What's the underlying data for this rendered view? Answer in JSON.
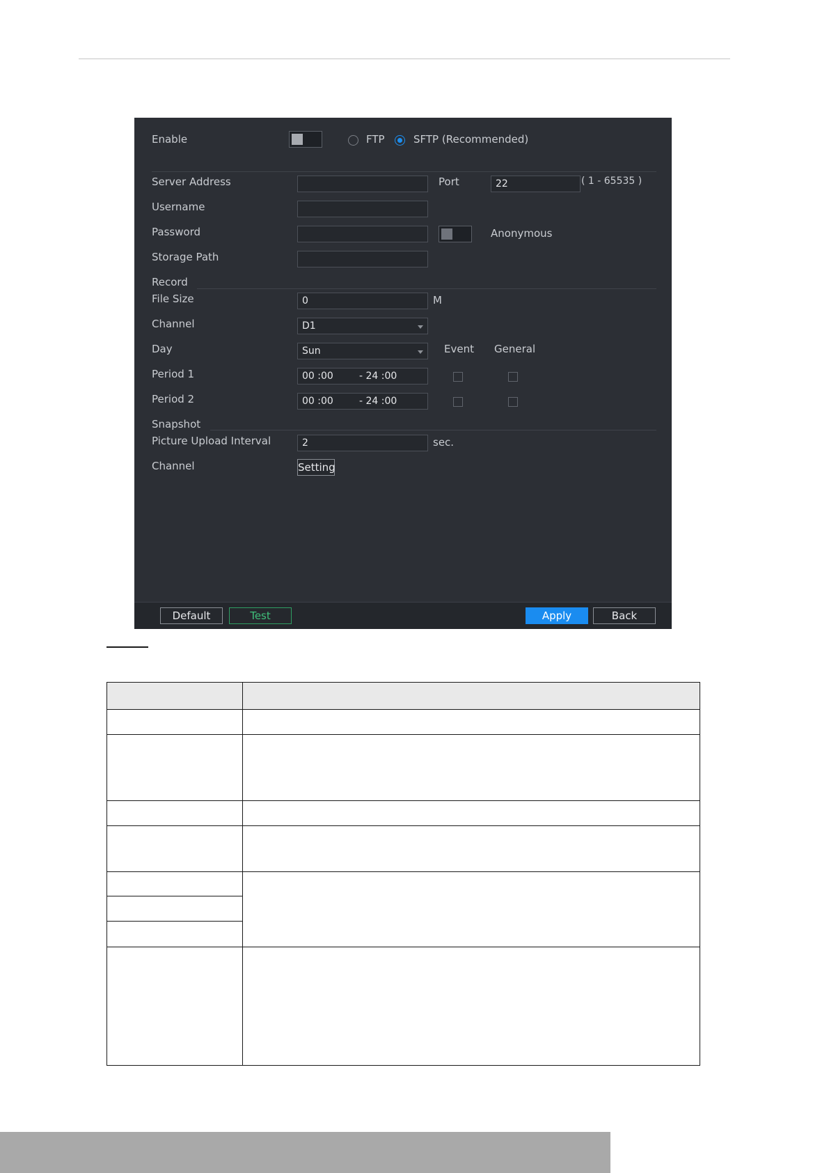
{
  "panel": {
    "enable_label": "Enable",
    "protocols": {
      "ftp": "FTP",
      "sftp": "SFTP (Recommended)",
      "selected": "sftp"
    },
    "server_address": {
      "label": "Server Address",
      "value": ""
    },
    "port": {
      "label": "Port",
      "value": "22",
      "range": "( 1 - 65535 )"
    },
    "username": {
      "label": "Username",
      "value": ""
    },
    "password": {
      "label": "Password",
      "value": ""
    },
    "anonymous_label": "Anonymous",
    "storage_path": {
      "label": "Storage Path",
      "value": ""
    },
    "record": {
      "section_label": "Record",
      "file_size": {
        "label": "File Size",
        "value": "0",
        "unit": "M"
      },
      "channel": {
        "label": "Channel",
        "value": "D1"
      },
      "day": {
        "label": "Day",
        "value": "Sun"
      },
      "event_header": "Event",
      "general_header": "General",
      "periods": [
        {
          "label": "Period 1",
          "start": "00 :00",
          "end": "- 24 :00"
        },
        {
          "label": "Period 2",
          "start": "00 :00",
          "end": "- 24 :00"
        }
      ]
    },
    "snapshot": {
      "section_label": "Snapshot",
      "interval": {
        "label": "Picture Upload Interval",
        "value": "2",
        "unit": "sec."
      },
      "channel_label": "Channel",
      "setting_button": "Setting"
    },
    "footer": {
      "default_button": "Default",
      "test_button": "Test",
      "apply_button": "Apply",
      "back_button": "Back"
    }
  }
}
